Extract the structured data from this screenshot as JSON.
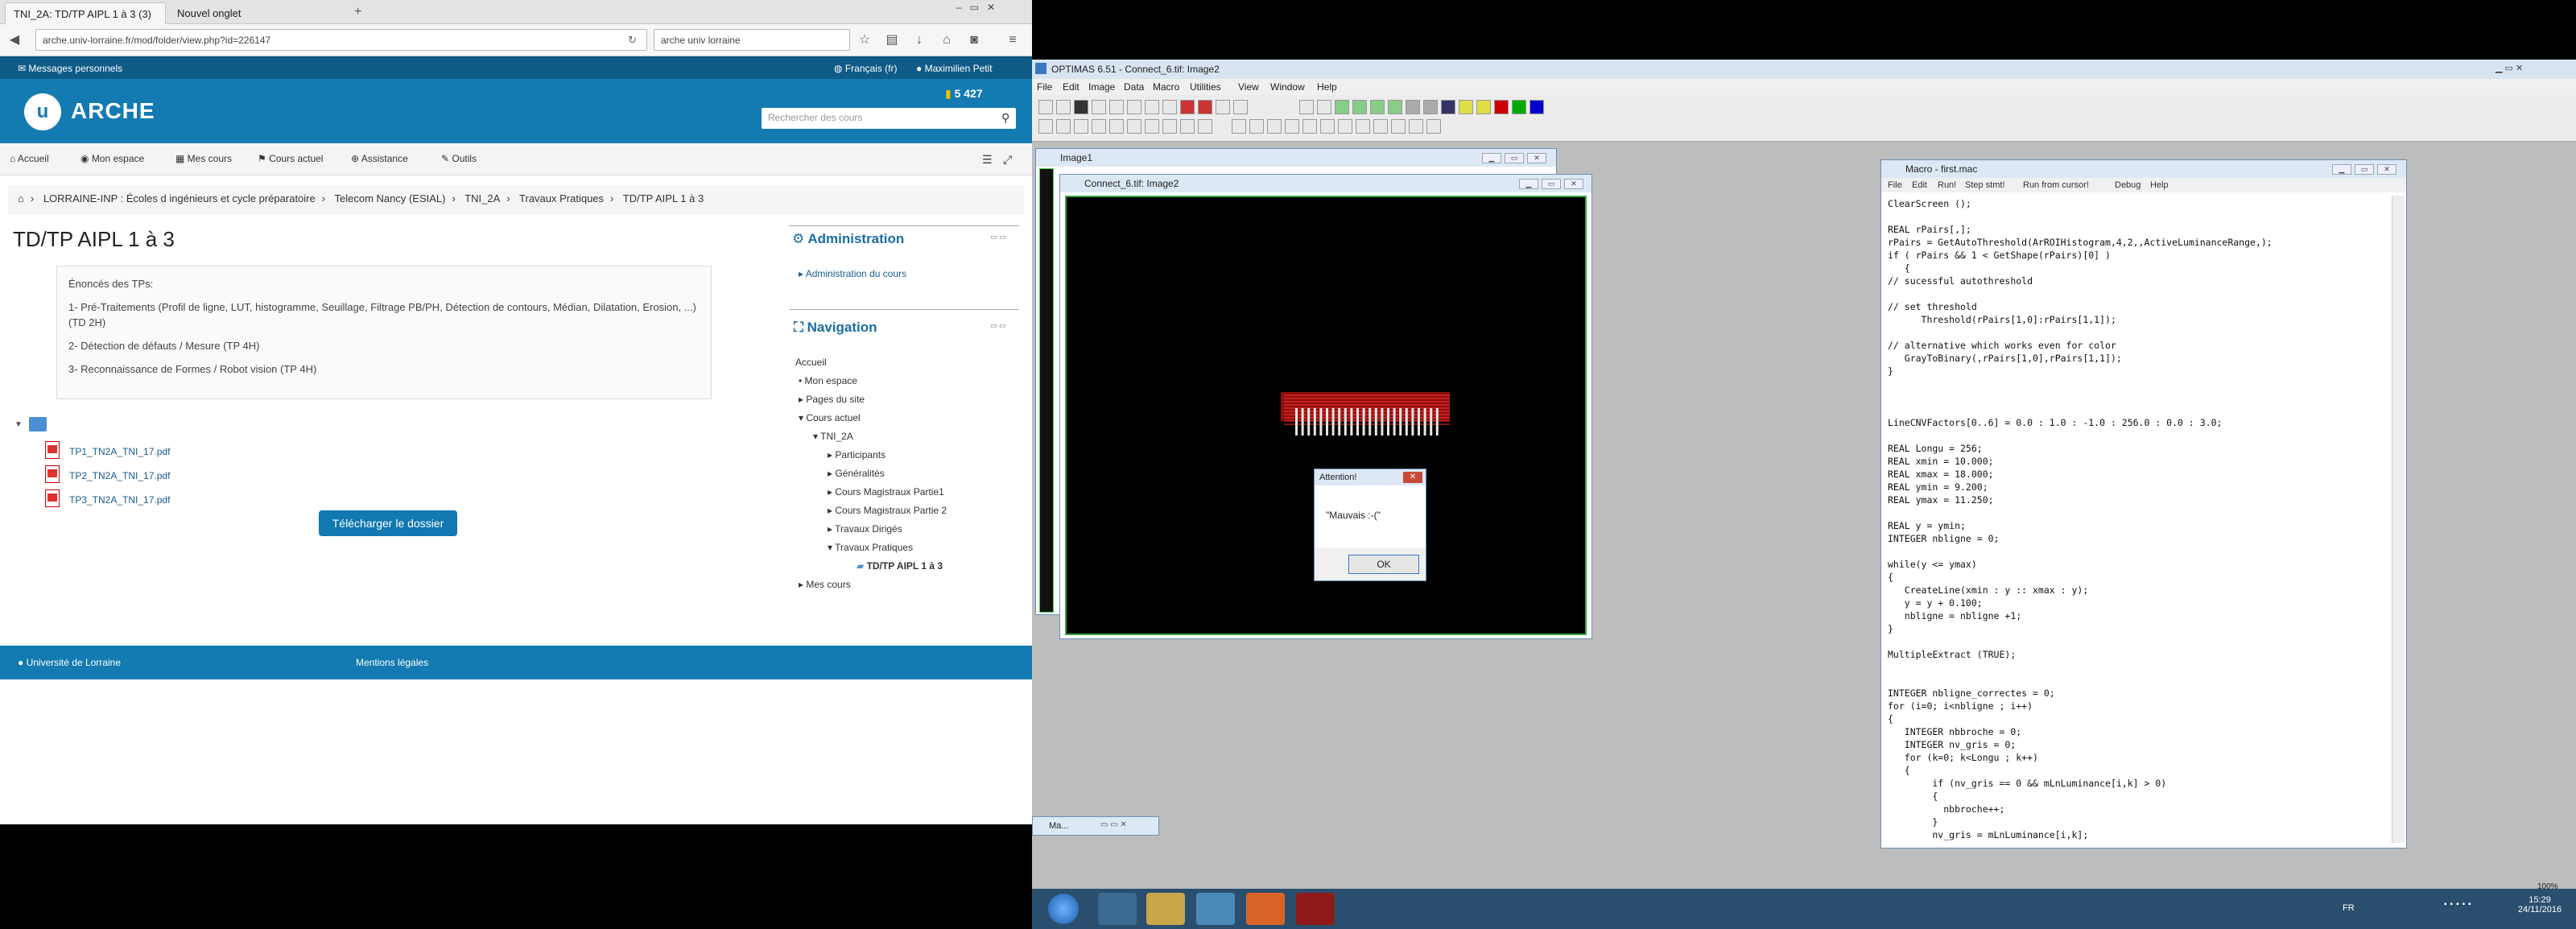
{
  "firefox": {
    "tabs": [
      {
        "label": "TNI_2A: TD/TP AIPL 1 à 3 (3)"
      },
      {
        "label": "Nouvel onglet"
      }
    ],
    "url": "arche.univ-lorraine.fr/mod/folder/view.php?id=226147",
    "search_value": "arche univ lorraine"
  },
  "moodle": {
    "messages_label": "Messages personnels",
    "language": "Français (fr)",
    "user_name": "Maximilien Petit",
    "points": "5 427",
    "site_name": "ARCHE",
    "search_placeholder": "Rechercher des cours",
    "menu": [
      "Accueil",
      "Mon espace",
      "Mes cours",
      "Cours actuel",
      "Assistance",
      "Outils"
    ],
    "breadcrumb": [
      "LORRAINE-INP : Écoles d ingénieurs et cycle préparatoire",
      "Telecom Nancy (ESIAL)",
      "TNI_2A",
      "Travaux Pratiques",
      "TD/TP AIPL 1 à 3"
    ],
    "page_title": "TD/TP AIPL 1 à 3",
    "description": {
      "heading": "Énoncés des TPs:",
      "items": [
        "1- Pré-Traitements  (Profil de ligne, LUT, histogramme, Seuillage, Filtrage PB/PH, Détection de contours, Médian, Dilatation, Erosion, ...) (TD 2H)",
        "2- Détection de défauts / Mesure (TP 4H)",
        "3- Reconnaissance de Formes / Robot vision (TP 4H)"
      ]
    },
    "files": [
      "TP1_TN2A_TNI_17.pdf",
      "TP2_TN2A_TNI_17.pdf",
      "TP3_TN2A_TNI_17.pdf"
    ],
    "download_button": "Télécharger le dossier",
    "admin_block": {
      "title": "Administration",
      "items": [
        "Administration du cours"
      ]
    },
    "nav_block": {
      "title": "Navigation",
      "items": [
        "Accueil",
        "Mon espace",
        "Pages du site",
        "Cours actuel",
        "TNI_2A",
        "Participants",
        "Généralités",
        "Cours Magistraux Partie1",
        "Cours Magistraux Partie 2",
        "Travaux Dirigés",
        "Travaux Pratiques",
        "TD/TP AIPL 1 à 3",
        "Mes cours"
      ]
    },
    "footer": [
      "Université de Lorraine",
      "Mentions légales"
    ]
  },
  "optimas": {
    "title": "OPTIMAS 6.51 - Connect_6.tif: Image2",
    "menu": [
      "File",
      "Edit",
      "Image",
      "Data",
      "Macro",
      "Utilities",
      "View",
      "Window",
      "Help"
    ],
    "image1_title": "Image1",
    "image2_title": "Connect_6.tif: Image2",
    "dialog": {
      "title": "Attention!",
      "message": "\"Mauvais :-(\"",
      "ok": "OK"
    },
    "macro_window": {
      "title": "Macro - first.mac",
      "menu": [
        "File",
        "Edit",
        "Run!",
        "Step stmt!",
        "Run from cursor!",
        "Debug",
        "Help"
      ],
      "code": "ClearScreen ();\n\nREAL rPairs[,];\nrPairs = GetAutoThreshold(ArROIHistogram,4,2,,ActiveLuminanceRange,);\nif ( rPairs && 1 < GetShape(rPairs)[0] )\n   {\n// sucessful autothreshold\n\n// set threshold\n      Threshold(rPairs[1,0]:rPairs[1,1]);\n\n// alternative which works even for color\n   GrayToBinary(,rPairs[1,0],rPairs[1,1]);\n}\n\n\n\nLineCNVFactors[0..6] = 0.0 : 1.0 : -1.0 : 256.0 : 0.0 : 3.0;\n\nREAL Longu = 256;\nREAL xmin = 10.000;\nREAL xmax = 18.000;\nREAL ymin = 9.200;\nREAL ymax = 11.250;\n\nREAL y = ymin;\nINTEGER nbligne = 0;\n\nwhile(y <= ymax)\n{\n   CreateLine(xmin : y :: xmax : y);\n   y = y + 0.100;\n   nbligne = nbligne +1;\n}\n\nMultipleExtract (TRUE);\n\n\nINTEGER nbligne_correctes = 0;\nfor (i=0; i<nbligne ; i++)\n{\n   INTEGER nbbroche = 0;\n   INTEGER nv_gris = 0;\n   for (k=0; k<Longu ; k++)\n   {\n        if (nv_gris == 0 && mLnLuminance[i,k] > 0)\n        {\n          nbbroche++;\n        }\n        nv_gris = mLnLuminance[i,k];"
    },
    "minimized_label": "Ma...",
    "zoom": "100%"
  },
  "taskbar": {
    "lang": "FR",
    "time": "15:29",
    "date": "24/11/2016"
  }
}
